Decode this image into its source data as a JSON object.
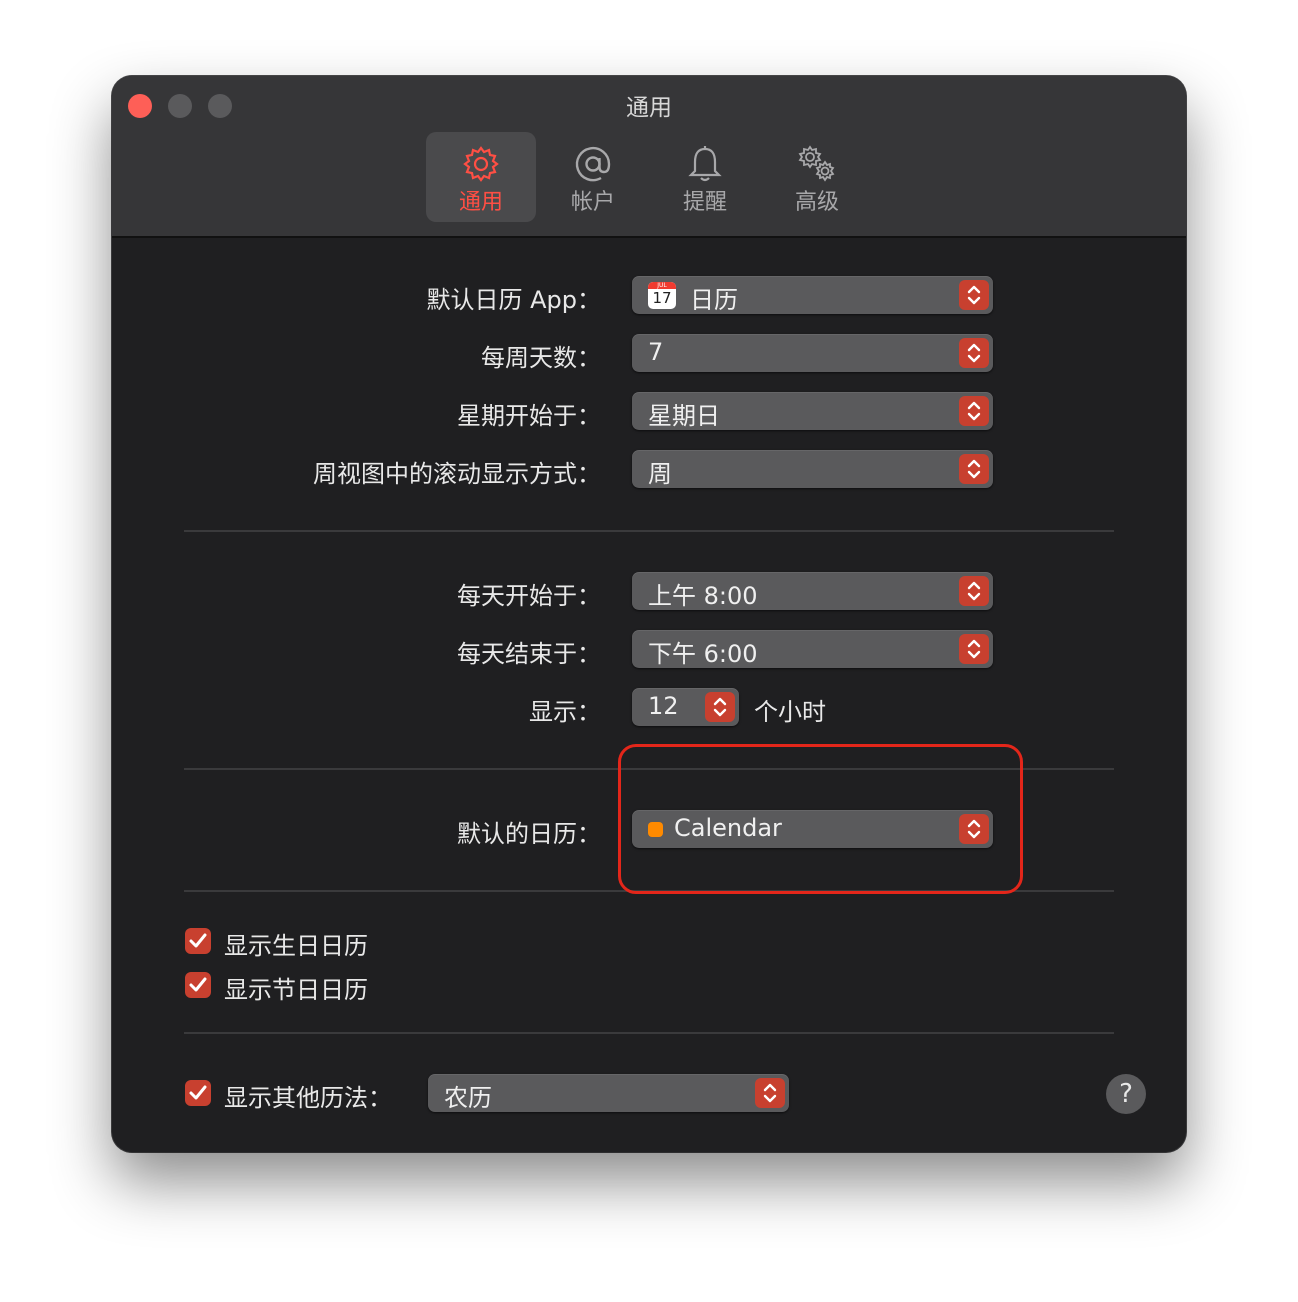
{
  "window": {
    "title": "通用",
    "accent_color": "#c8402f",
    "tabs": [
      {
        "label": "通用",
        "icon": "gear-icon",
        "active": true
      },
      {
        "label": "帐户",
        "icon": "at-icon",
        "active": false
      },
      {
        "label": "提醒",
        "icon": "bell-icon",
        "active": false
      },
      {
        "label": "高级",
        "icon": "gears-icon",
        "active": false
      }
    ]
  },
  "section1": {
    "default_app": {
      "label": "默认日历 App：",
      "value": "日历",
      "icon": "calendar-app-icon",
      "icon_month": "JUL",
      "icon_day": "17"
    },
    "days_per_week": {
      "label": "每周天数：",
      "value": "7"
    },
    "week_starts": {
      "label": "星期开始于：",
      "value": "星期日"
    },
    "scroll_mode": {
      "label": "周视图中的滚动显示方式：",
      "value": "周"
    }
  },
  "section2": {
    "day_starts": {
      "label": "每天开始于：",
      "value": "上午 8:00"
    },
    "day_ends": {
      "label": "每天结束于：",
      "value": "下午 6:00"
    },
    "show": {
      "label": "显示：",
      "value": "12",
      "unit": "个小时"
    }
  },
  "section3": {
    "default_calendar": {
      "label": "默认的日历：",
      "value": "Calendar",
      "color": "#ff8a00"
    }
  },
  "checkboxes": [
    {
      "label": "显示生日日历",
      "checked": true
    },
    {
      "label": "显示节日日历",
      "checked": true
    }
  ],
  "other_calendar": {
    "label": "显示其他历法：",
    "checked": true,
    "value": "农历"
  },
  "help": {
    "label": "?"
  }
}
